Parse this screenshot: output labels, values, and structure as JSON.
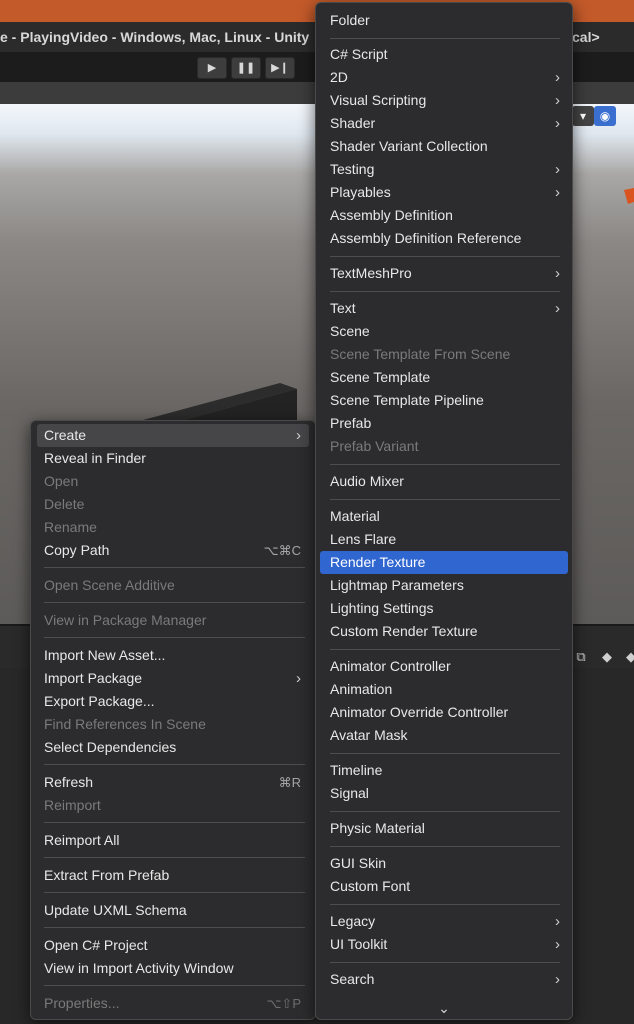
{
  "window": {
    "title": "e - PlayingVideo - Windows, Mac, Linux - Unity",
    "title_suffix": "cal>"
  },
  "toolbar": {
    "play_icon": "play-icon",
    "pause_icon": "pause-icon",
    "step_icon": "step-icon"
  },
  "colors": {
    "highlight": "#2f66d0",
    "menu_bg": "#2c2c2e",
    "title_accent": "#c35a2a"
  },
  "context_menu": {
    "items": [
      {
        "label": "Create",
        "submenu": true,
        "highlighted": true
      },
      {
        "label": "Reveal in Finder"
      },
      {
        "label": "Open",
        "disabled": true
      },
      {
        "label": "Delete",
        "disabled": true
      },
      {
        "label": "Rename",
        "disabled": true
      },
      {
        "label": "Copy Path",
        "shortcut": "⌥⌘C"
      },
      {
        "label": "Open Scene Additive",
        "disabled": true
      },
      {
        "label": "View in Package Manager",
        "disabled": true
      },
      {
        "label": "Import New Asset..."
      },
      {
        "label": "Import Package",
        "submenu": true
      },
      {
        "label": "Export Package..."
      },
      {
        "label": "Find References In Scene",
        "disabled": true
      },
      {
        "label": "Select Dependencies"
      },
      {
        "label": "Refresh",
        "shortcut": "⌘R"
      },
      {
        "label": "Reimport",
        "disabled": true
      },
      {
        "label": "Reimport All"
      },
      {
        "label": "Extract From Prefab"
      },
      {
        "label": "Update UXML Schema"
      },
      {
        "label": "Open C# Project"
      },
      {
        "label": "View in Import Activity Window"
      },
      {
        "label": "Properties...",
        "disabled": true,
        "shortcut": "⌥⇧P"
      }
    ]
  },
  "create_submenu": {
    "items": [
      {
        "label": "Folder"
      },
      {
        "label": "C# Script"
      },
      {
        "label": "2D",
        "submenu": true
      },
      {
        "label": "Visual Scripting",
        "submenu": true
      },
      {
        "label": "Shader",
        "submenu": true
      },
      {
        "label": "Shader Variant Collection"
      },
      {
        "label": "Testing",
        "submenu": true
      },
      {
        "label": "Playables",
        "submenu": true
      },
      {
        "label": "Assembly Definition"
      },
      {
        "label": "Assembly Definition Reference"
      },
      {
        "label": "TextMeshPro",
        "submenu": true
      },
      {
        "label": "Text",
        "submenu": true
      },
      {
        "label": "Scene"
      },
      {
        "label": "Scene Template From Scene",
        "disabled": true
      },
      {
        "label": "Scene Template"
      },
      {
        "label": "Scene Template Pipeline"
      },
      {
        "label": "Prefab"
      },
      {
        "label": "Prefab Variant",
        "disabled": true
      },
      {
        "label": "Audio Mixer"
      },
      {
        "label": "Material"
      },
      {
        "label": "Lens Flare"
      },
      {
        "label": "Render Texture",
        "selected": true
      },
      {
        "label": "Lightmap Parameters"
      },
      {
        "label": "Lighting Settings"
      },
      {
        "label": "Custom Render Texture"
      },
      {
        "label": "Animator Controller"
      },
      {
        "label": "Animation"
      },
      {
        "label": "Animator Override Controller"
      },
      {
        "label": "Avatar Mask"
      },
      {
        "label": "Timeline"
      },
      {
        "label": "Signal"
      },
      {
        "label": "Physic Material"
      },
      {
        "label": "GUI Skin"
      },
      {
        "label": "Custom Font"
      },
      {
        "label": "Legacy",
        "submenu": true
      },
      {
        "label": "UI Toolkit",
        "submenu": true
      },
      {
        "label": "Search",
        "submenu": true
      }
    ]
  }
}
